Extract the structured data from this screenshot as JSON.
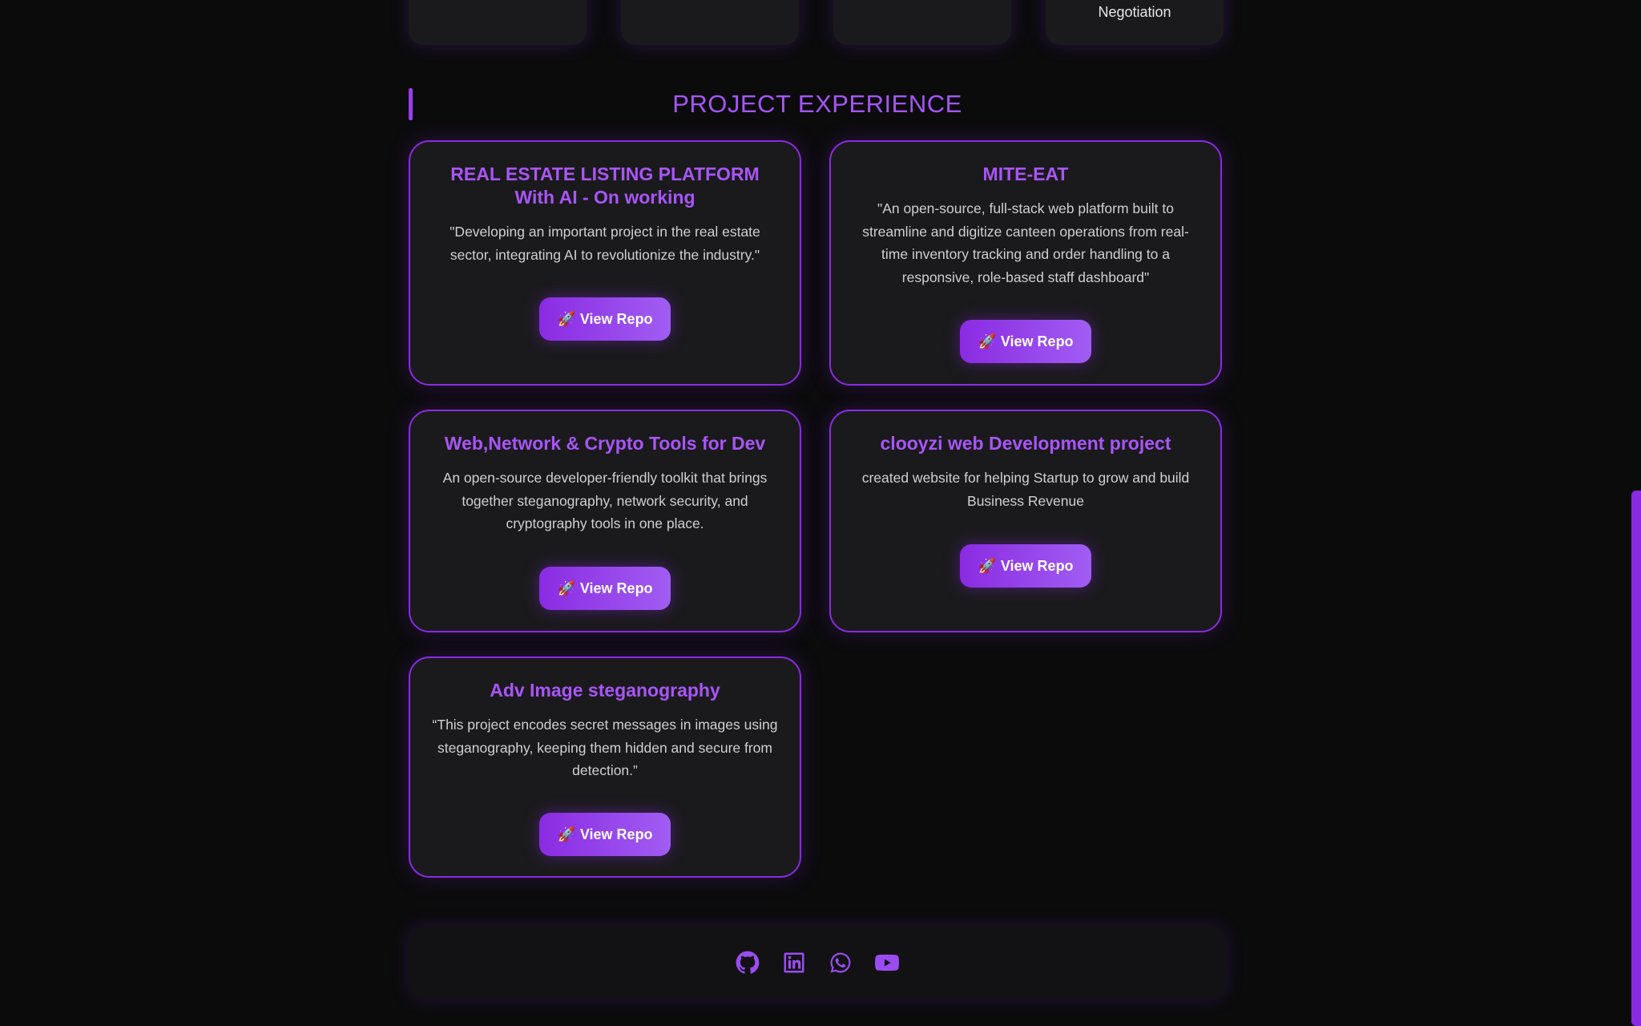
{
  "skills": {
    "cards": [
      {
        "label": ""
      },
      {
        "label": ""
      },
      {
        "label": ""
      },
      {
        "label": "Negotiation"
      }
    ]
  },
  "section": {
    "title": "PROJECT EXPERIENCE"
  },
  "projects": [
    {
      "title": "REAL ESTATE LISTING PLATFORM With AI - On working",
      "description": "\"Developing an important project in the real estate sector, integrating AI to revolutionize the industry.\"",
      "button_label": "View Repo"
    },
    {
      "title": "MITE-EAT",
      "description": "\"An open-source, full-stack web platform built to streamline and digitize canteen operations from real-time inventory tracking and order handling to a responsive, role-based staff dashboard\"",
      "button_label": "View Repo"
    },
    {
      "title": "Web,Network & Crypto Tools for Dev",
      "description": "An open-source developer-friendly toolkit that brings together steganography, network security, and cryptography tools in one place.",
      "button_label": "View Repo"
    },
    {
      "title": "clooyzi web Development project",
      "description": "created website for helping Startup to grow and build Business Revenue",
      "button_label": "View Repo"
    },
    {
      "title": "Adv Image steganography",
      "description": "“This project encodes secret messages in images using steganography, keeping them hidden and secure from detection.”",
      "button_label": "View Repo"
    }
  ],
  "button_icon": "🚀",
  "footer": {
    "icons": [
      "github-icon",
      "linkedin-icon",
      "whatsapp-icon",
      "youtube-icon"
    ]
  },
  "colors": {
    "accent": "#8a2be2",
    "accent_light": "#a955f7",
    "background": "#0b0b0c",
    "card": "#1a1a1c"
  }
}
